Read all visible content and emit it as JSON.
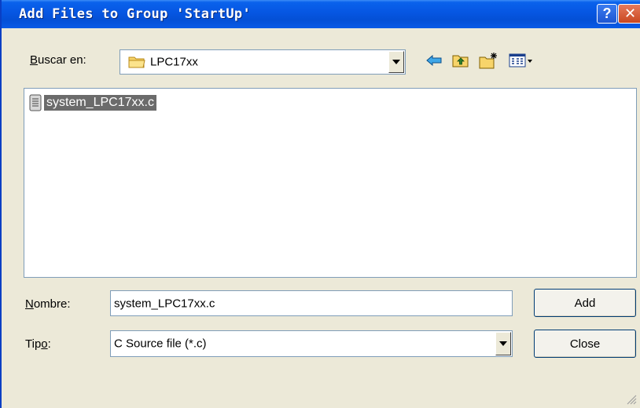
{
  "window": {
    "title": "Add Files to Group 'StartUp'",
    "help_symbol": "?",
    "close_symbol": "✕"
  },
  "lookin": {
    "label_accel": "B",
    "label_rest": "uscar en:",
    "folder": "LPC17xx"
  },
  "toolbar": {
    "icons": [
      "back-arrow-icon",
      "up-folder-icon",
      "new-folder-icon",
      "view-menu-icon"
    ]
  },
  "files": [
    {
      "name": "system_LPC17xx.c",
      "icon": "c-source-file-icon",
      "selected": true
    }
  ],
  "filename": {
    "label_accel": "N",
    "label_rest": "ombre:",
    "value": "system_LPC17xx.c"
  },
  "filetype": {
    "label_pre": "Tip",
    "label_accel": "o",
    "label_post": ":",
    "value": "C Source file (*.c)"
  },
  "buttons": {
    "add": "Add",
    "close": "Close"
  },
  "colors": {
    "titlebar": "#0656e2",
    "dialog_bg": "#ece9d8",
    "selection": "#6b6b6b"
  }
}
